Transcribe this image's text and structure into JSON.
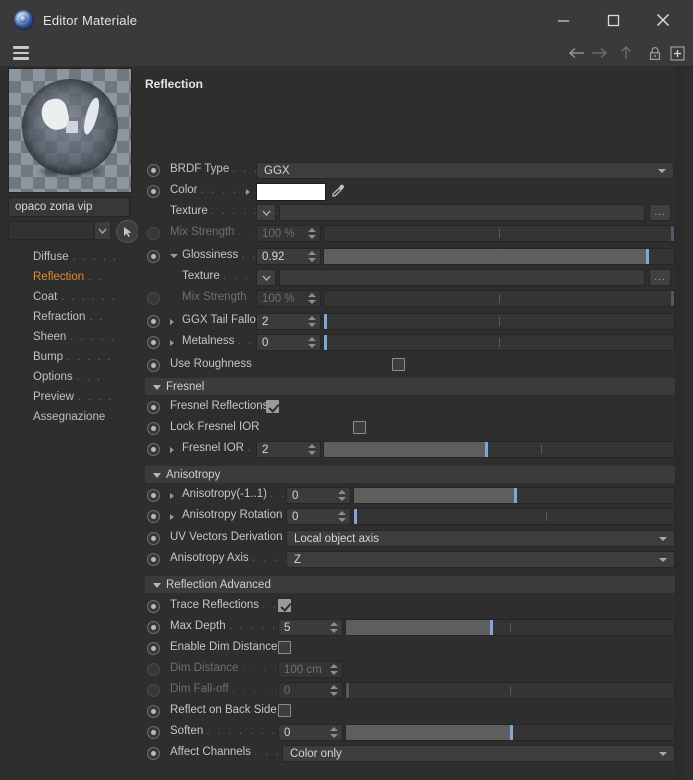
{
  "window": {
    "title": "Editor Materiale",
    "app_icon": "material-sphere-icon",
    "controls": {
      "minimize": "minimize-icon",
      "maximize": "maximize-icon",
      "close": "close-icon"
    }
  },
  "toolbar": {
    "menu": "hamburger-icon",
    "back": "arrow-left-icon",
    "forward": "arrow-right-icon",
    "up": "arrow-up-icon",
    "lock": "lock-icon",
    "add": "plus-box-icon"
  },
  "sidebar": {
    "material_name": "opaco zona vip",
    "layer_value": "",
    "layer_dropdown": "chevron-down-icon",
    "pick_button": "cursor-arrow-icon",
    "preview_label": "material-preview",
    "items": [
      {
        "label": "Diffuse",
        "dots": ". . . . .",
        "active": false
      },
      {
        "label": "Reflection",
        "dots": ". .",
        "active": true
      },
      {
        "label": "Coat",
        "dots": ". . . . . .",
        "active": false
      },
      {
        "label": "Refraction",
        "dots": ". .",
        "active": false
      },
      {
        "label": "Sheen",
        "dots": ". . . . .",
        "active": false
      },
      {
        "label": "Bump",
        "dots": ". . . . .",
        "active": false
      },
      {
        "label": "Options",
        "dots": ". . .",
        "active": false
      },
      {
        "label": "Preview",
        "dots": ". . . .",
        "active": false
      },
      {
        "label": "Assegnazione",
        "dots": "",
        "active": false
      }
    ]
  },
  "panel": {
    "title": "Reflection",
    "accent_color": "#e08a33",
    "slider_handle_color": "#7fa8d8",
    "rows": {
      "brdf_type": {
        "label": "BRDF Type",
        "dots": ". . . .",
        "value": "GGX"
      },
      "color": {
        "label": "Color",
        "dots": ". . . . . .",
        "swatch": "#ffffff",
        "dropper": "eyedropper-icon"
      },
      "color_texture": {
        "label": "Texture",
        "dots": ". . . . . . .",
        "value": "",
        "browse": "..."
      },
      "color_mix_strength": {
        "label": "Mix Strength",
        "dots": ". . . .",
        "value": "100 %"
      },
      "glossiness": {
        "label": "Glossiness",
        "dots": ". . .",
        "value": "0.92"
      },
      "gloss_texture": {
        "label": "Texture",
        "dots": ". . . . .",
        "value": "",
        "browse": "..."
      },
      "gloss_mix_strength": {
        "label": "Mix Strength",
        "dots": "",
        "value": "100 %"
      },
      "ggx_tail_falloff": {
        "label": "GGX Tail Falloff",
        "dots": "",
        "value": "2"
      },
      "metalness": {
        "label": "Metalness",
        "dots": ". . .",
        "value": "0"
      },
      "use_roughness": {
        "label": "Use Roughness",
        "dots": "",
        "checked": false
      },
      "fresnel_group": {
        "label": "Fresnel"
      },
      "fresnel_reflections": {
        "label": "Fresnel Reflections",
        "dots": "",
        "checked": true
      },
      "lock_fresnel_ior": {
        "label": "Lock Fresnel IOR",
        "dots": "",
        "checked": false
      },
      "fresnel_ior": {
        "label": "Fresnel IOR",
        "dots": ". .",
        "value": "2"
      },
      "anisotropy_group": {
        "label": "Anisotropy"
      },
      "anisotropy": {
        "label": "Anisotropy(-1..1)",
        "dots": ". .",
        "value": "0"
      },
      "anisotropy_rotation": {
        "label": "Anisotropy Rotation",
        "dots": "",
        "value": "0"
      },
      "uv_vectors_derivation": {
        "label": "UV Vectors Derivation",
        "dots": "",
        "value": "Local object axis"
      },
      "anisotropy_axis": {
        "label": "Anisotropy Axis",
        "dots": ". . . .",
        "value": "Z"
      },
      "reflection_advanced_group": {
        "label": "Reflection Advanced"
      },
      "trace_reflections": {
        "label": "Trace Reflections",
        "dots": ". .",
        "checked": true
      },
      "max_depth": {
        "label": "Max Depth",
        "dots": ". . . . . .",
        "value": "5"
      },
      "enable_dim_distance": {
        "label": "Enable Dim Distance",
        "dots": "",
        "checked": false
      },
      "dim_distance": {
        "label": "Dim Distance",
        "dots": ". . . . . .",
        "value": "100 cm"
      },
      "dim_falloff": {
        "label": "Dim Fall-off",
        "dots": ". . . . . .",
        "value": "0"
      },
      "reflect_on_back_side": {
        "label": "Reflect on Back Side",
        "dots": "",
        "checked": false
      },
      "soften": {
        "label": "Soften",
        "dots": ". . . . . . . . .",
        "value": "0"
      },
      "affect_channels": {
        "label": "Affect Channels",
        "dots": ". . .",
        "value": "Color only"
      }
    }
  }
}
